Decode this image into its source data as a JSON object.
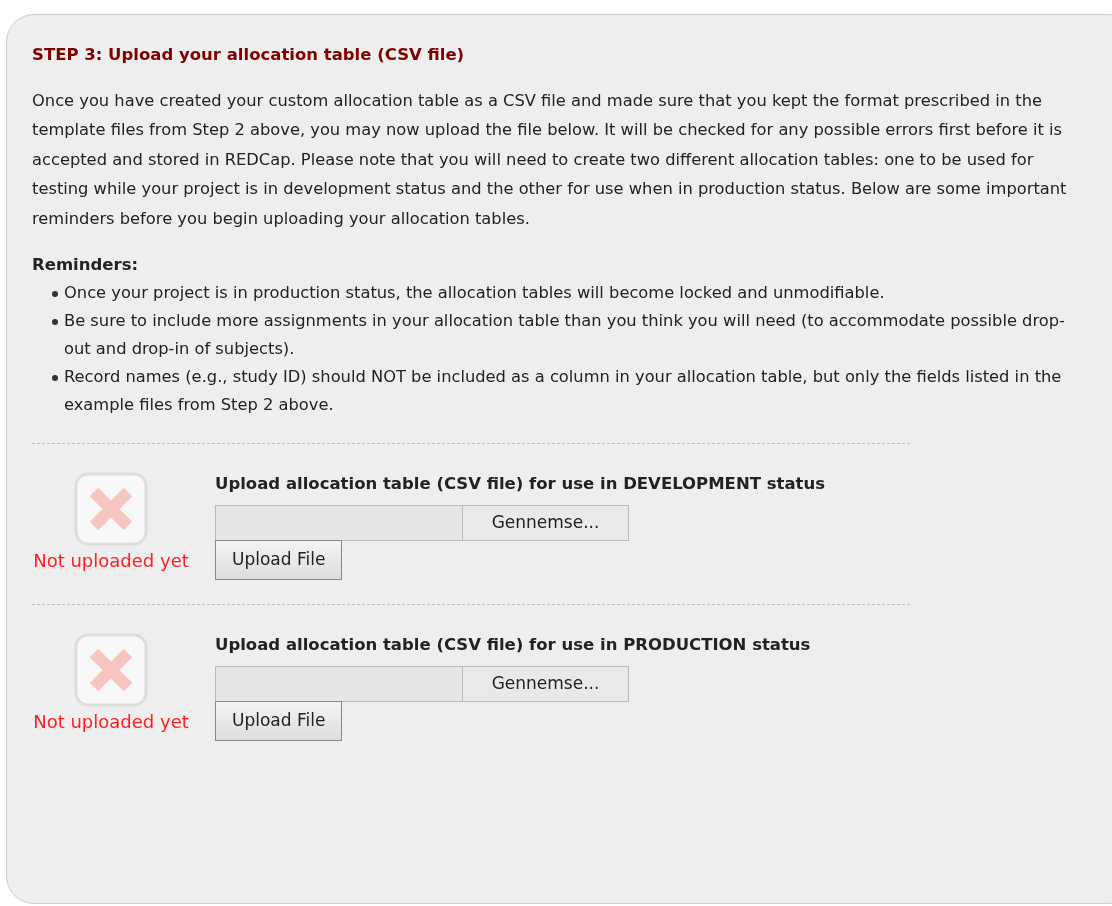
{
  "heading": "STEP 3: Upload your allocation table (CSV file)",
  "intro": "Once you have created your custom allocation table as a CSV file and made sure that you kept the format prescribed in the template files from Step 2 above, you may now upload the file below. It will be checked for any possible errors first before it is accepted and stored in REDCap. Please note that you will need to create two different allocation tables: one to be used for testing while your project is in development status and the other for use when in production status. Below are some important reminders before you begin uploading your allocation tables.",
  "reminders": {
    "title": "Reminders:",
    "items": [
      "Once your project is in production status, the allocation tables will become locked and unmodifiable.",
      "Be sure to include more assignments in your allocation table than you think you will need (to accommodate possible drop-out and drop-in of subjects).",
      "Record names (e.g., study ID) should NOT be included as a column in your allocation table, but only the fields listed in the example files from Step 2 above."
    ]
  },
  "uploads": [
    {
      "uploaded": false,
      "status": "Not uploaded yet",
      "label": "Upload allocation table (CSV file) for use in DEVELOPMENT status",
      "browse": "Gennemse...",
      "button": "Upload File"
    },
    {
      "uploaded": false,
      "status": "Not uploaded yet",
      "label": "Upload allocation table (CSV file) for use in PRODUCTION status",
      "browse": "Gennemse...",
      "button": "Upload File"
    }
  ]
}
